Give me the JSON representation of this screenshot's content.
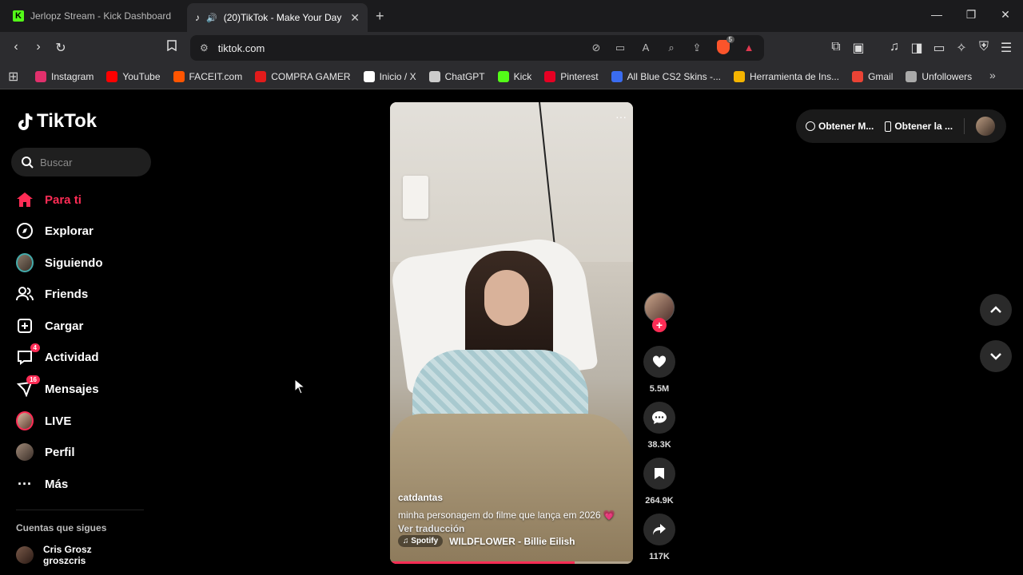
{
  "browser": {
    "tabs": [
      {
        "title": "Jerlopz Stream - Kick Dashboard",
        "active": false
      },
      {
        "title": "(20)TikTok - Make Your Day",
        "active": true
      }
    ],
    "new_tab": "+",
    "url": "tiktok.com",
    "brave_badge": "5",
    "bookmarks": [
      {
        "label": "Instagram",
        "icon": "instagram-icon",
        "color": "#e1306c"
      },
      {
        "label": "YouTube",
        "icon": "youtube-icon",
        "color": "#ff0000"
      },
      {
        "label": "FACEIT.com",
        "icon": "faceit-icon",
        "color": "#ff5500"
      },
      {
        "label": "COMPRA GAMER",
        "icon": "compragamer-icon",
        "color": "#e21b1b"
      },
      {
        "label": "Inicio / X",
        "icon": "x-icon",
        "color": "#ffffff"
      },
      {
        "label": "ChatGPT",
        "icon": "chatgpt-icon",
        "color": "#cccccc"
      },
      {
        "label": "Kick",
        "icon": "kick-icon",
        "color": "#53fc18"
      },
      {
        "label": "Pinterest",
        "icon": "pinterest-icon",
        "color": "#e60023"
      },
      {
        "label": "All Blue CS2 Skins -...",
        "icon": "skins-icon",
        "color": "#3a6cf0"
      },
      {
        "label": "Herramienta de Ins...",
        "icon": "search-tool-icon",
        "color": "#f4b400"
      },
      {
        "label": "Gmail",
        "icon": "gmail-icon",
        "color": "#ea4335"
      },
      {
        "label": "Unfollowers",
        "icon": "unfollowers-icon",
        "color": "#aaaaaa"
      }
    ]
  },
  "sidebar": {
    "logo": "TikTok",
    "search_placeholder": "Buscar",
    "items": [
      {
        "label": "Para ti",
        "icon": "home-icon",
        "active": true
      },
      {
        "label": "Explorar",
        "icon": "compass-icon"
      },
      {
        "label": "Siguiendo",
        "icon": "following-avatar-icon"
      },
      {
        "label": "Friends",
        "icon": "friends-icon"
      },
      {
        "label": "Cargar",
        "icon": "upload-icon"
      },
      {
        "label": "Actividad",
        "icon": "activity-icon",
        "badge": "4"
      },
      {
        "label": "Mensajes",
        "icon": "messages-icon",
        "badge": "16"
      },
      {
        "label": "LIVE",
        "icon": "live-icon"
      },
      {
        "label": "Perfil",
        "icon": "profile-icon"
      },
      {
        "label": "Más",
        "icon": "more-icon"
      }
    ],
    "following_title": "Cuentas que sigues",
    "following_accounts": [
      {
        "name": "Cris Grosz",
        "handle": "groszcris"
      }
    ]
  },
  "video": {
    "author": "catdantas",
    "caption": "minha personagem do filme que lança em 2026 💗",
    "translate": "Ver traducción",
    "music_source": "Spotify",
    "music": "WILDFLOWER - Billie Eilish",
    "progress": 0.76,
    "more": "···"
  },
  "actions": {
    "likes": "5.5M",
    "comments": "38.3K",
    "saves": "264.9K",
    "shares": "117K"
  },
  "topright": {
    "get_app": "Obtener M...",
    "get_desktop": "Obtener la ..."
  },
  "colors": {
    "accent": "#fe2c55",
    "chrome_dark": "#1b1b1d",
    "chrome": "#2c2c2f"
  }
}
